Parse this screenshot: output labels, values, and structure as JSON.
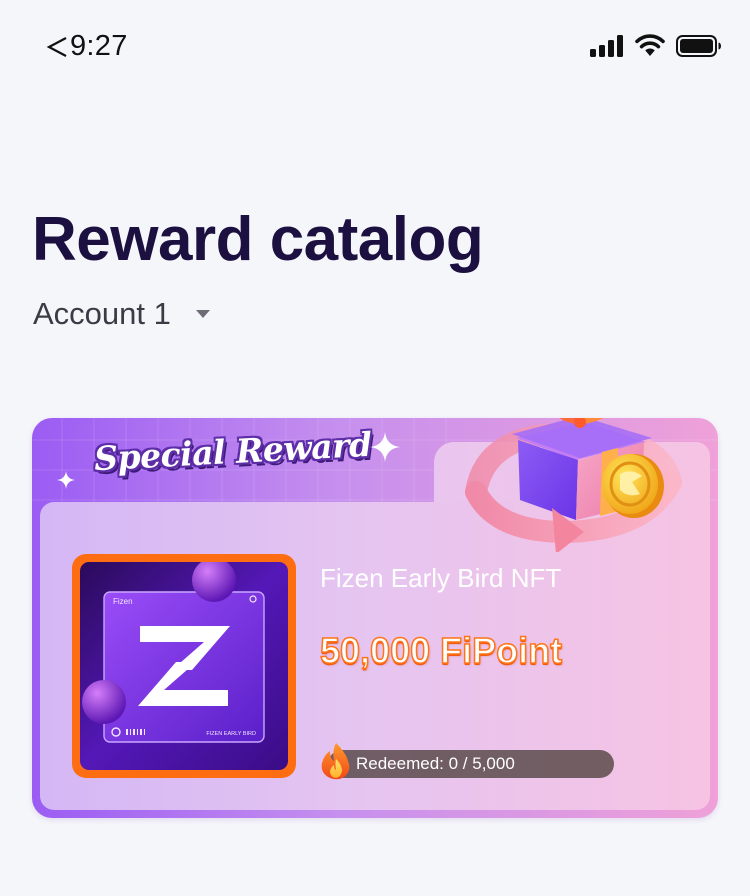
{
  "status_bar": {
    "time": "9:27",
    "icons": [
      "back-arrow-icon",
      "cellular-signal-icon",
      "wifi-icon",
      "battery-icon"
    ]
  },
  "header": {
    "title": "Reward catalog",
    "account_selector": {
      "value": "Account 1",
      "icon": "caret-down-icon"
    }
  },
  "reward_card": {
    "banner": "Special Reward",
    "name": "Fizen Early Bird NFT",
    "price": "50,000 FiPoint",
    "redeemed": "Redeemed: 0 / 5,000",
    "redeemed_count": 0,
    "redeemed_total": 5000,
    "icons": [
      "sparkle-icon",
      "gift-box-icon",
      "coin-icon",
      "fire-icon"
    ],
    "nft_image": {
      "brand": "Fizen",
      "caption": "FIZEN EARLY BIRD"
    }
  },
  "colors": {
    "page_background": "#f5f6fa",
    "title": "#1c1040",
    "card_gradient_start": "#9b5cf3",
    "card_gradient_end": "#efa1d8",
    "nft_frame": "#ff6d12",
    "price_stroke": "#ff7418"
  }
}
